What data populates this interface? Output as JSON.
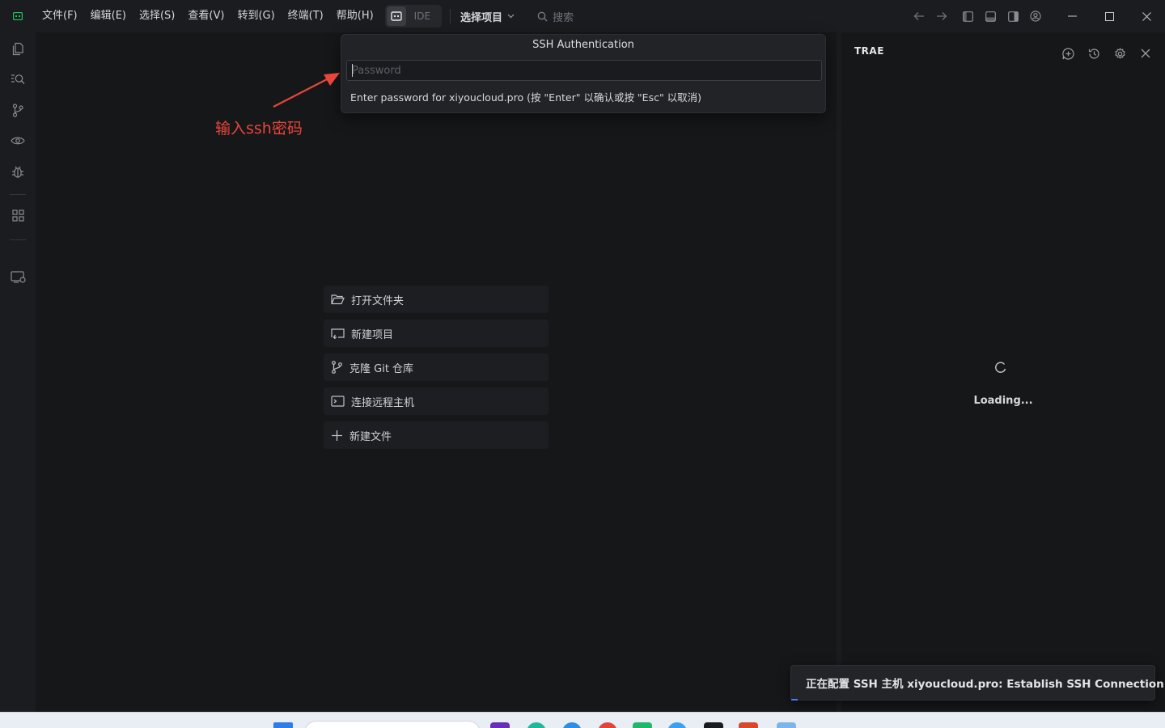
{
  "menu": {
    "items": [
      "文件(F)",
      "编辑(E)",
      "选择(S)",
      "查看(V)",
      "转到(G)",
      "终端(T)",
      "帮助(H)"
    ],
    "mode_label": "IDE",
    "project_label": "选择项目",
    "search_placeholder": "搜索"
  },
  "welcome": {
    "open_folder": "打开文件夹",
    "new_project": "新建项目",
    "clone_git": "克隆 Git 仓库",
    "connect_remote": "连接远程主机",
    "new_file": "新建文件"
  },
  "quick_input": {
    "title": "SSH Authentication",
    "placeholder": "Password",
    "value": "",
    "message": "Enter password for xiyoucloud.pro (按 \"Enter\" 以确认或按 \"Esc\" 以取消)"
  },
  "annotation": {
    "text": "输入ssh密码",
    "color": "#e8463b"
  },
  "side_panel": {
    "title": "TRAE",
    "loading": "Loading..."
  },
  "notification": {
    "text": "正在配置 SSH 主机 xiyoucloud.pro: Establish SSH Connection"
  },
  "colors": {
    "accent": "#3b82f6",
    "logo": "#22c55e"
  }
}
